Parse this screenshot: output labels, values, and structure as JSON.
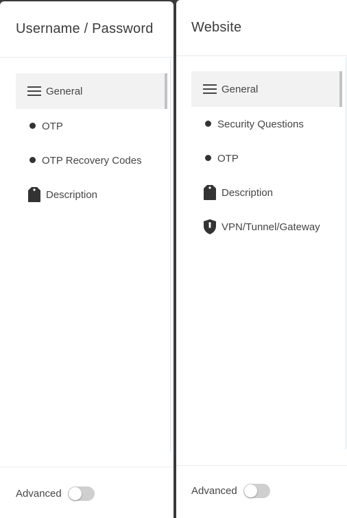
{
  "left_panel": {
    "title": "Username / Password",
    "nav": [
      {
        "label": "General",
        "icon": "menu-icon"
      },
      {
        "label": "OTP",
        "icon": "bullet-icon"
      },
      {
        "label": "OTP Recovery Codes",
        "icon": "bullet-icon"
      },
      {
        "label": "Description",
        "icon": "tag-icon"
      }
    ],
    "footer": {
      "advanced_label": "Advanced",
      "advanced_enabled": false
    }
  },
  "right_panel": {
    "title": "Website",
    "nav": [
      {
        "label": "General",
        "icon": "menu-icon"
      },
      {
        "label": "Security Questions",
        "icon": "bullet-icon"
      },
      {
        "label": "OTP",
        "icon": "bullet-icon"
      },
      {
        "label": "Description",
        "icon": "tag-icon"
      },
      {
        "label": "VPN/Tunnel/Gateway",
        "icon": "shield-icon"
      }
    ],
    "footer": {
      "advanced_label": "Advanced",
      "advanced_enabled": false
    }
  },
  "colors": {
    "active_bg": "#f2f2f2",
    "scroll_indicator": "#c2c2c2",
    "toggle_off": "#cfcfcf"
  }
}
